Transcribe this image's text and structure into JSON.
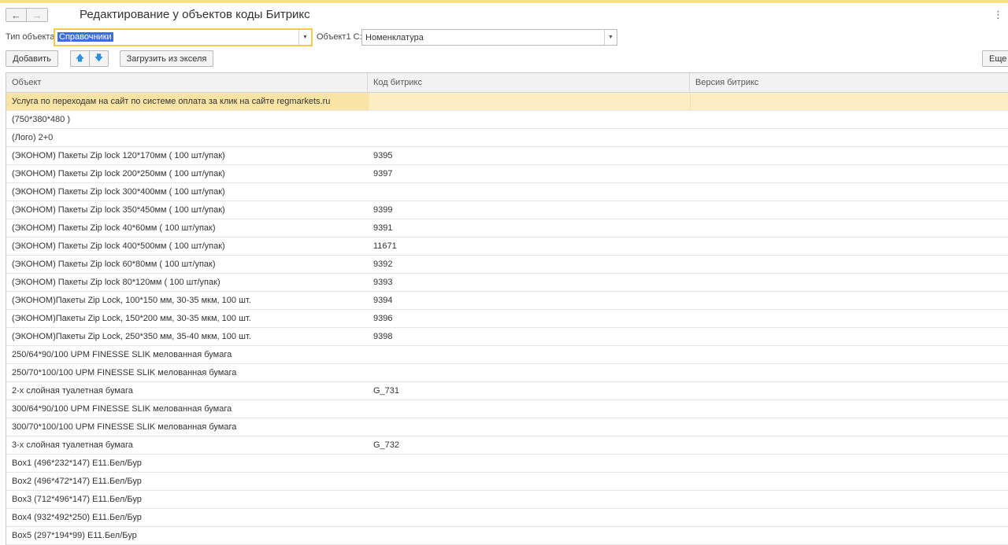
{
  "header": {
    "back_icon": "arrow-left-icon",
    "forward_icon": "arrow-right-icon",
    "title": "Редактирование у объектов коды Битрикс",
    "menu_icon": "more-vertical-icon"
  },
  "fields": {
    "object_type_label": "Тип объекта:",
    "object_type_value": "Справочники",
    "object1c_label": "Объект1 С:",
    "object1c_value": "Номенклатура"
  },
  "toolbar": {
    "add_label": "Добавить",
    "up_icon": "arrow-up-icon",
    "down_icon": "arrow-down-icon",
    "load_excel_label": "Загрузить из экселя",
    "more_label": "Еще"
  },
  "table": {
    "columns": [
      "Объект",
      "Код битрикс",
      "Версия битрикс"
    ],
    "rows": [
      {
        "object": "Услуга по переходам на сайт по системе оплата за клик на сайте regmarkets.ru",
        "code": "",
        "version": ""
      },
      {
        "object": "(750*380*480 )",
        "code": "",
        "version": ""
      },
      {
        "object": "(Лого) 2+0",
        "code": "",
        "version": ""
      },
      {
        "object": "(ЭКОНОМ) Пакеты Zip lock 120*170мм ( 100 шт/упак)",
        "code": "9395",
        "version": ""
      },
      {
        "object": "(ЭКОНОМ) Пакеты Zip lock 200*250мм ( 100 шт/упак)",
        "code": "9397",
        "version": ""
      },
      {
        "object": "(ЭКОНОМ) Пакеты Zip lock 300*400мм ( 100 шт/упак)",
        "code": "",
        "version": ""
      },
      {
        "object": "(ЭКОНОМ) Пакеты Zip lock 350*450мм ( 100 шт/упак)",
        "code": "9399",
        "version": ""
      },
      {
        "object": "(ЭКОНОМ) Пакеты Zip lock 40*60мм ( 100 шт/упак)",
        "code": "9391",
        "version": ""
      },
      {
        "object": "(ЭКОНОМ) Пакеты Zip lock 400*500мм ( 100 шт/упак)",
        "code": "11671",
        "version": ""
      },
      {
        "object": "(ЭКОНОМ) Пакеты Zip lock 60*80мм ( 100 шт/упак)",
        "code": "9392",
        "version": ""
      },
      {
        "object": "(ЭКОНОМ) Пакеты Zip lock 80*120мм ( 100 шт/упак)",
        "code": "9393",
        "version": ""
      },
      {
        "object": "(ЭКОНОМ)Пакеты Zip Lock, 100*150 мм, 30-35 мкм, 100 шт.",
        "code": "9394",
        "version": ""
      },
      {
        "object": "(ЭКОНОМ)Пакеты Zip Lock, 150*200 мм, 30-35 мкм, 100 шт.",
        "code": "9396",
        "version": ""
      },
      {
        "object": "(ЭКОНОМ)Пакеты Zip Lock, 250*350 мм, 35-40 мкм, 100 шт.",
        "code": "9398",
        "version": ""
      },
      {
        "object": "250/64*90/100 UPM FINESSE SLIK  мелованная бумага",
        "code": "",
        "version": ""
      },
      {
        "object": "250/70*100/100 UPM FINESSE SLIK  мелованная бумага",
        "code": "",
        "version": ""
      },
      {
        "object": "2-х слойная туалетная бумага",
        "code": "G_731",
        "version": ""
      },
      {
        "object": "300/64*90/100 UPM FINESSE SLIK  мелованная бумага",
        "code": "",
        "version": ""
      },
      {
        "object": "300/70*100/100 UPM FINESSE SLIK  мелованная бумага",
        "code": "",
        "version": ""
      },
      {
        "object": "3-х слойная туалетная бумага",
        "code": "G_732",
        "version": ""
      },
      {
        "object": "Box1 (496*232*147) E11.Бел/Бур",
        "code": "",
        "version": ""
      },
      {
        "object": "Box2 (496*472*147) E11.Бел/Бур",
        "code": "",
        "version": ""
      },
      {
        "object": "Box3 (712*496*147) E11.Бел/Бур",
        "code": "",
        "version": ""
      },
      {
        "object": "Box4 (932*492*250) E11.Бел/Бур",
        "code": "",
        "version": ""
      },
      {
        "object": "Box5 (297*194*99) E11.Бел/Бур",
        "code": "",
        "version": ""
      }
    ]
  },
  "colors": {
    "selected_row": "#f9e4a5",
    "focus_border": "#f2c94c",
    "selection_highlight": "#3b6fd4",
    "arrow_accent": "#2f8fd8"
  }
}
